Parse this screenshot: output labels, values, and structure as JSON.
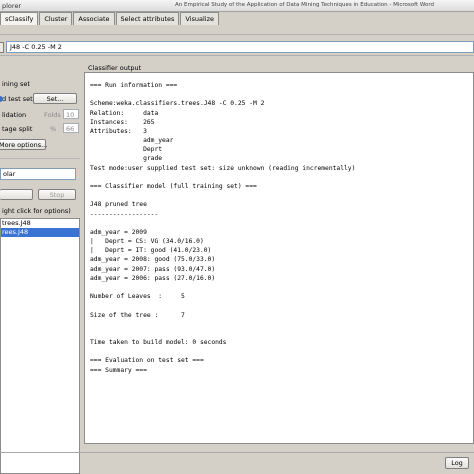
{
  "window": {
    "title": "plorer",
    "center_title": "An Empirical Study of the Application of Data Mining Techniques in Education - Microsoft Word"
  },
  "tabs": [
    "sClassify",
    "Cluster",
    "Associate",
    "Select attributes",
    "Visualize"
  ],
  "classifier": {
    "value": "J48 -C 0.25 -M 2"
  },
  "test_options": {
    "header": "ining set",
    "supplied_test_set": "d test set",
    "set_button": "Set...",
    "cross_validation": "lidation",
    "folds_label": "Folds",
    "folds_value": "10",
    "percentage_split": "tage split",
    "percent_symbol": "%",
    "percent_value": "66",
    "more_options": "More options..."
  },
  "class_select": "olar",
  "stop_button": "Stop",
  "result_list": {
    "header": "ight click for options)",
    "items": [
      "trees.J48",
      "rees.J48"
    ]
  },
  "output": {
    "header": "Classifier output",
    "lines": [
      "=== Run information ===",
      "",
      "Scheme:weka.classifiers.trees.J48 -C 0.25 -M 2",
      "Relation:     data",
      "Instances:    265",
      "Attributes:   3",
      "              adm_year",
      "              Deprt",
      "              grade",
      "Test mode:user supplied test set: size unknown (reading incrementally)",
      "",
      "=== Classifier model (full training set) ===",
      "",
      "J48 pruned tree",
      "------------------",
      "",
      "adm_year = 2009",
      "|   Deprt = CS: VG (34.0/16.0)",
      "|   Deprt = IT: good (41.0/23.0)",
      "adm_year = 2008: good (75.0/33.0)",
      "adm_year = 2007: pass (93.0/47.0)",
      "adm_year = 2006: pass (27.0/16.0)",
      "",
      "Number of Leaves  :     5",
      "",
      "Size of the tree :      7",
      "",
      "",
      "Time taken to build model: 0 seconds",
      "",
      "=== Evaluation on test set ===",
      "=== Summary ==="
    ]
  },
  "status": {
    "log_button": "Log"
  }
}
